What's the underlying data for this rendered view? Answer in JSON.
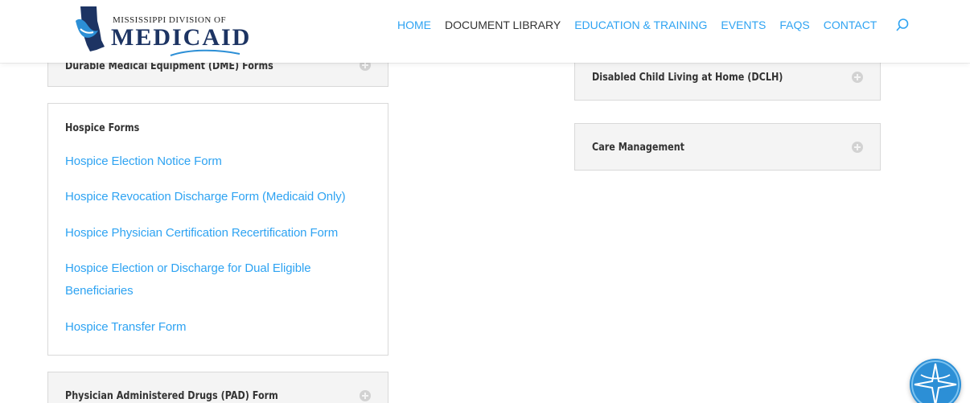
{
  "logo": {
    "small_text": "MISSISSIPPI DIVISION OF",
    "big_text": "MEDICAID"
  },
  "nav": {
    "items": [
      {
        "label": "HOME",
        "color": "#2ea3f2"
      },
      {
        "label": "DOCUMENT LIBRARY",
        "color": "#333333"
      },
      {
        "label": "EDUCATION & TRAINING",
        "color": "#2ea3f2"
      },
      {
        "label": "EVENTS",
        "color": "#2ea3f2"
      },
      {
        "label": "FAQS",
        "color": "#2ea3f2"
      },
      {
        "label": "CONTACT",
        "color": "#2ea3f2"
      }
    ],
    "search_icon": "search-icon"
  },
  "left_column": {
    "dme": {
      "title": "Durable Medical Equipment (DME) Forms"
    },
    "hospice": {
      "title": "Hospice Forms",
      "links": [
        "Hospice Election Notice Form",
        "Hospice Revocation Discharge Form (Medicaid Only)",
        "Hospice Physician Certification Recertification Form",
        "Hospice Election or Discharge for Dual Eligible",
        "Beneficiaries",
        "Hospice Transfer Form"
      ]
    },
    "pad": {
      "title": "Physician Administered Drugs (PAD) Form"
    }
  },
  "right_column": {
    "dclh": {
      "title": "Disabled Child Living at Home (DCLH)"
    },
    "care": {
      "title": "Care Management"
    }
  },
  "colors": {
    "link": "#2ea3f2",
    "brand_navy": "#1d3463",
    "brand_blue": "#2c8fd6"
  },
  "floating_button_icon": "accessibility-compass-icon"
}
